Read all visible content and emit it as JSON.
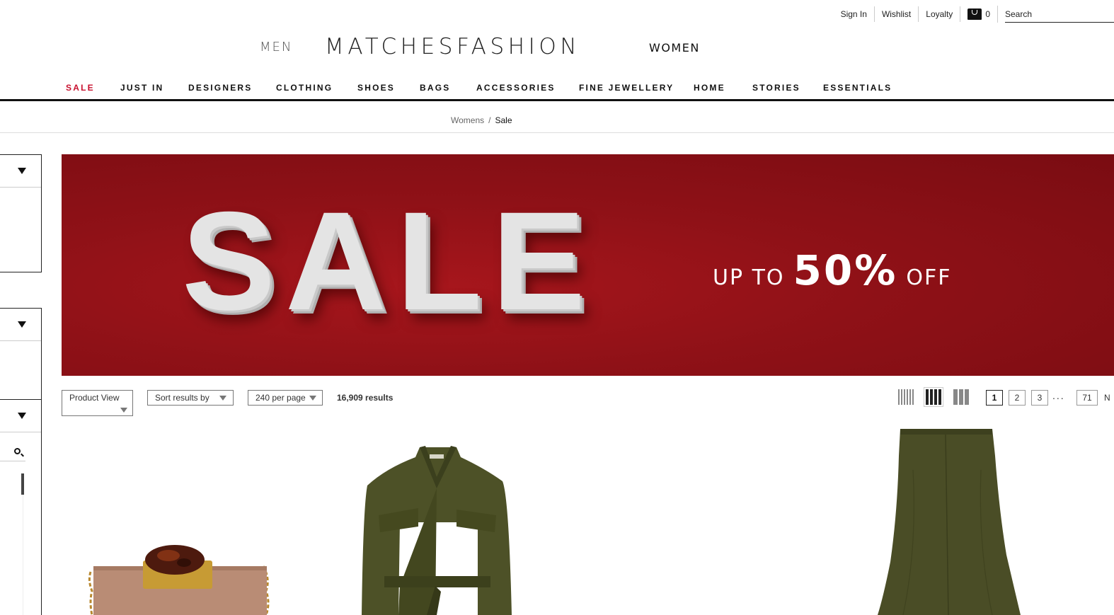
{
  "util": {
    "sign_in": "Sign In",
    "wishlist": "Wishlist",
    "loyalty": "Loyalty",
    "bag_count": "0",
    "search_placeholder": "Search"
  },
  "header": {
    "men": "MEN",
    "logo": "MATCHESFASHION",
    "women": "WOMEN"
  },
  "nav": [
    "SALE",
    "JUST IN",
    "DESIGNERS",
    "CLOTHING",
    "SHOES",
    "BAGS",
    "ACCESSORIES",
    "FINE JEWELLERY",
    "HOME",
    "STORIES",
    "ESSENTIALS"
  ],
  "breadcrumb": {
    "parent": "Womens",
    "separator": "/",
    "current": "Sale"
  },
  "banner": {
    "headline": "SALE",
    "prefix": "UP TO",
    "amount": "50%",
    "suffix": "OFF"
  },
  "toolbar": {
    "product_view": "Product View",
    "sort": "Sort results by",
    "per_page": "240 per page",
    "results": "16,909 results"
  },
  "pagination": {
    "pages": [
      "1",
      "2",
      "3"
    ],
    "dots": "...",
    "last": "71",
    "next": "N"
  },
  "colors": {
    "accent_red": "#c8102e",
    "banner_red": "#8f1117",
    "olive": "#4a4d26"
  },
  "icons": [
    "bag-icon",
    "chevron-down-icon",
    "search-icon",
    "grid-4-icon",
    "grid-3-icon",
    "grid-2-icon"
  ]
}
